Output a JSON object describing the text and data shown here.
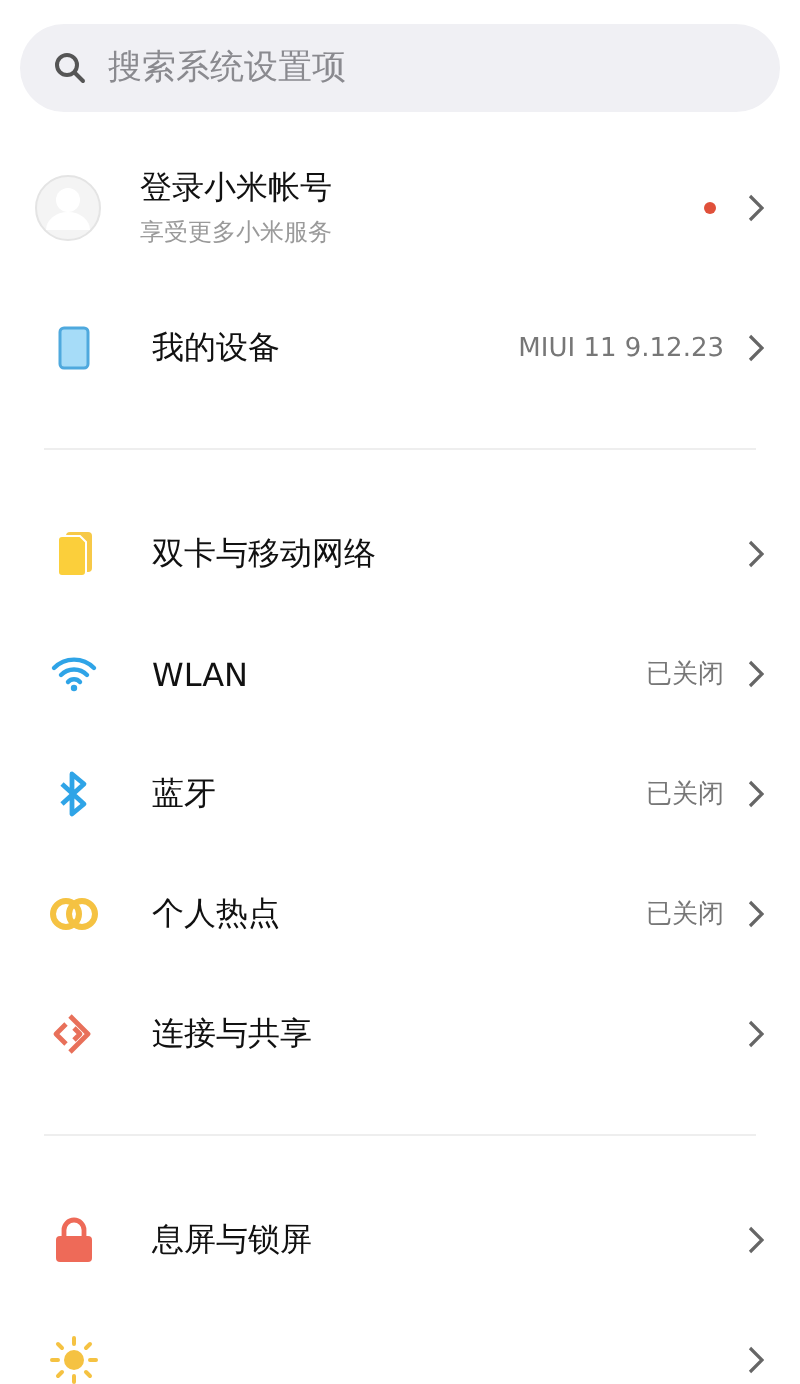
{
  "search": {
    "placeholder": "搜索系统设置项"
  },
  "account": {
    "title": "登录小米帐号",
    "subtitle": "享受更多小米服务",
    "notification": true
  },
  "groups": [
    [
      {
        "kind": "device",
        "title": "我的设备",
        "value": "MIUI 11 9.12.23"
      }
    ],
    [
      {
        "kind": "sim",
        "title": "双卡与移动网络"
      },
      {
        "kind": "wifi",
        "title": "WLAN",
        "value": "已关闭"
      },
      {
        "kind": "bluetooth",
        "title": "蓝牙",
        "value": "已关闭"
      },
      {
        "kind": "hotspot",
        "title": "个人热点",
        "value": "已关闭"
      },
      {
        "kind": "share",
        "title": "连接与共享"
      }
    ],
    [
      {
        "kind": "lock",
        "title": "息屏与锁屏"
      },
      {
        "kind": "sun"
      }
    ]
  ]
}
